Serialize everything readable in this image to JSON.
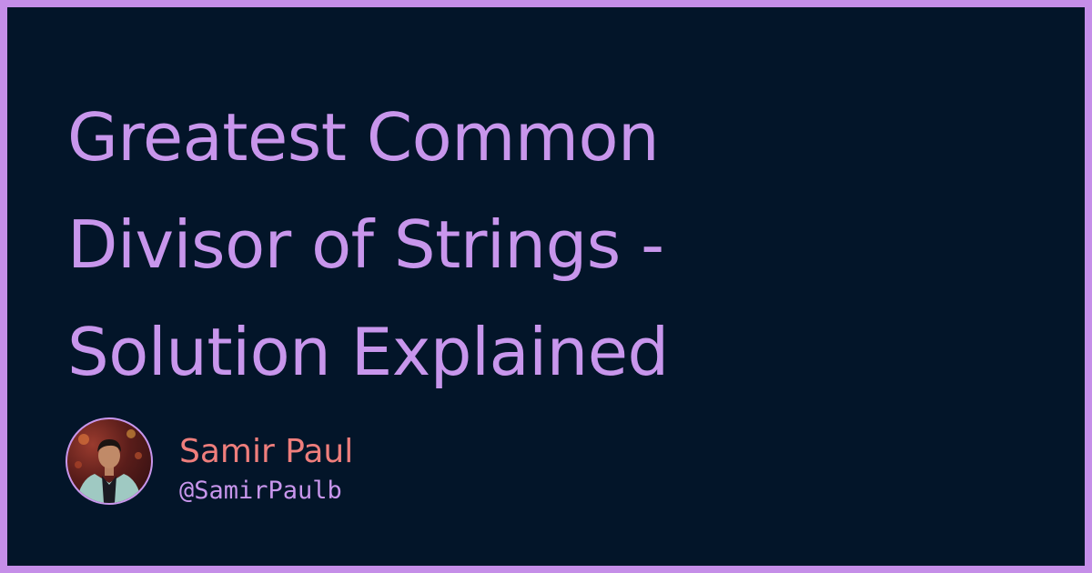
{
  "post": {
    "title_lines": [
      "Greatest Common",
      "Divisor of Strings -",
      "Solution Explained"
    ]
  },
  "author": {
    "name": "Samir Paul",
    "handle": "@SamirPaulb"
  },
  "colors": {
    "frame": "#c58ee8",
    "background": "#031529",
    "title": "#c896ec",
    "author_name": "#ef7e7c",
    "author_handle": "#c896ec"
  }
}
